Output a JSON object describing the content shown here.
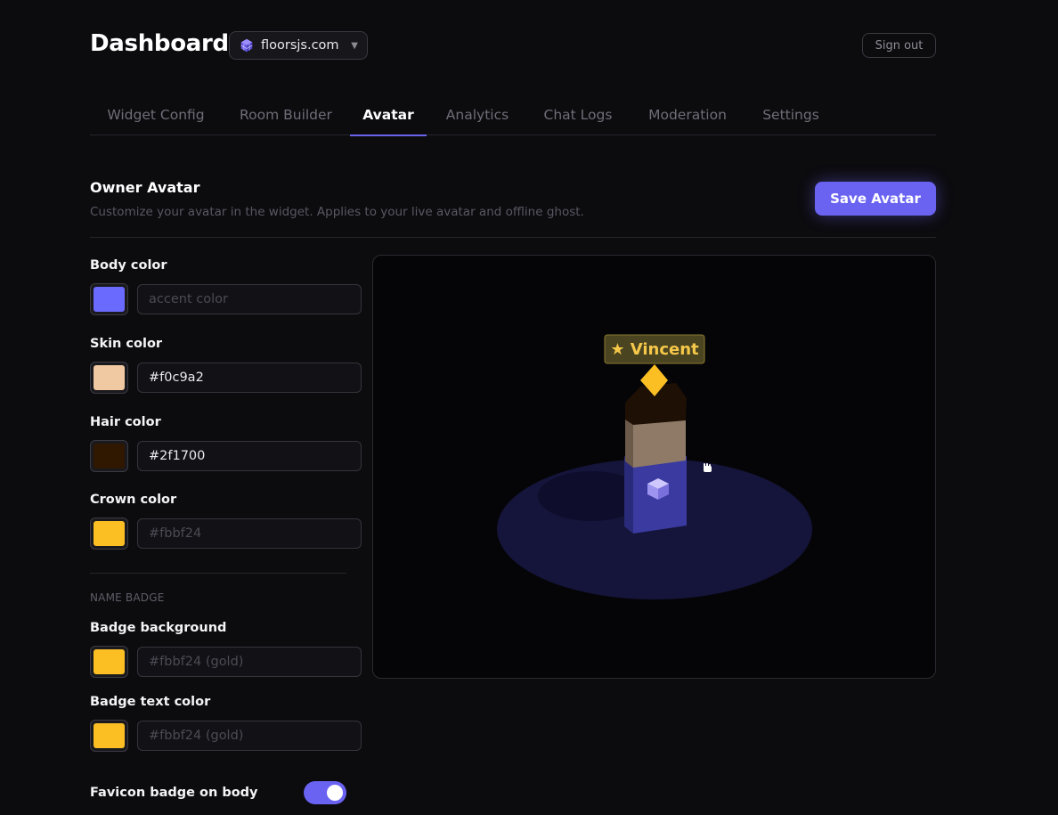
{
  "header": {
    "title": "Dashboard",
    "site": {
      "name": "floorsjs.com",
      "icon": "cube-logo-icon"
    },
    "sign_out": "Sign out"
  },
  "tabs": [
    {
      "label": "Widget Config",
      "active": false
    },
    {
      "label": "Room Builder",
      "active": false
    },
    {
      "label": "Avatar",
      "active": true
    },
    {
      "label": "Analytics",
      "active": false
    },
    {
      "label": "Chat Logs",
      "active": false
    },
    {
      "label": "Moderation",
      "active": false
    },
    {
      "label": "Settings",
      "active": false
    }
  ],
  "section": {
    "title": "Owner Avatar",
    "description": "Customize your avatar in the widget. Applies to your live avatar and offline ghost.",
    "save_label": "Save Avatar"
  },
  "fields": {
    "body": {
      "label": "Body color",
      "value": "",
      "placeholder": "accent color",
      "swatch": "#6b6aff"
    },
    "skin": {
      "label": "Skin color",
      "value": "#f0c9a2",
      "placeholder": "",
      "swatch": "#f0c9a2"
    },
    "hair": {
      "label": "Hair color",
      "value": "#2f1700",
      "placeholder": "",
      "swatch": "#2f1700"
    },
    "crown": {
      "label": "Crown color",
      "value": "",
      "placeholder": "#fbbf24",
      "swatch": "#fbbf24"
    }
  },
  "name_badge": {
    "group_label": "NAME BADGE",
    "background": {
      "label": "Badge background",
      "value": "",
      "placeholder": "#fbbf24 (gold)",
      "swatch": "#fbbf24"
    },
    "text_color": {
      "label": "Badge text color",
      "value": "",
      "placeholder": "#fbbf24 (gold)",
      "swatch": "#fbbf24"
    }
  },
  "favicon_badge": {
    "label": "Favicon badge on body",
    "enabled": true
  },
  "preview": {
    "badge_text": "★ Vincent",
    "colors": {
      "platform": "#15143a",
      "body_front": "#3a3aa0",
      "body_side": "#2a2a7a",
      "head_front": "#8e7a66",
      "head_side": "#6b5a4a",
      "hair": "#1e1005",
      "crown": "#fbbf24",
      "badge_bg": "#4a4420",
      "badge_text": "#f5c84a"
    }
  }
}
